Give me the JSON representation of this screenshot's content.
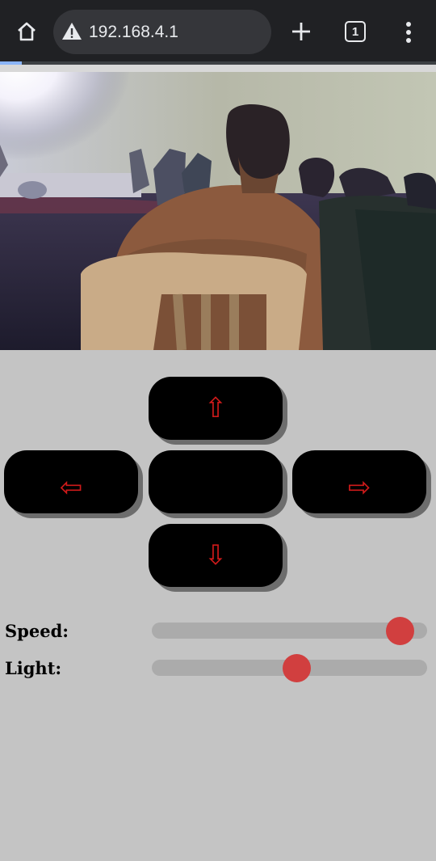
{
  "browser": {
    "url": "192.168.4.1",
    "tab_count": "1",
    "load_progress": 0.05
  },
  "icons": {
    "home": "home-icon",
    "warning": "not-secure-warning-icon",
    "new_tab": "plus-icon",
    "tabs": "tab-switcher-icon",
    "menu": "kebab-menu-icon"
  },
  "controls": {
    "forward": {
      "glyph": "⇧"
    },
    "left": {
      "glyph": "⇦"
    },
    "stop": {
      "glyph": ""
    },
    "right": {
      "glyph": "⇨"
    },
    "backward": {
      "glyph": "⇩"
    }
  },
  "sliders": {
    "speed": {
      "label": "Speed:",
      "value": 0.9
    },
    "light": {
      "label": "Light:",
      "value": 0.525
    }
  },
  "colors": {
    "page_bg": "#c4c4c4",
    "button_bg": "#000000",
    "arrow": "#d01a1a",
    "slider_thumb": "#d13f3f",
    "slider_track": "#ababab"
  }
}
